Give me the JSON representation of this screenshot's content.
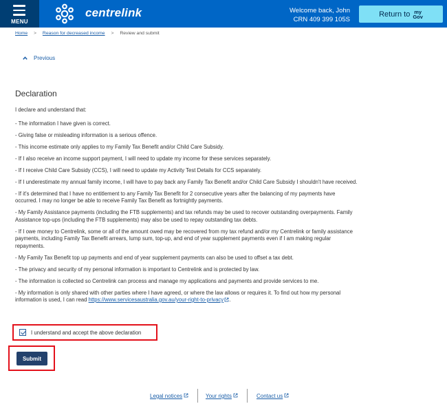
{
  "header": {
    "menu_label": "MENU",
    "brand": "centrelink",
    "welcome_line": "Welcome back, John",
    "crn_line": "CRN 409 399 105S",
    "return_label": "Return to",
    "mygov_line1": "my",
    "mygov_line2": "Gov",
    "colors": {
      "bar": "#0066c6",
      "menu": "#003e73",
      "return_button": "#7fe0f6"
    }
  },
  "breadcrumb": {
    "home": "Home",
    "reason": "Reason for decreased income",
    "current": "Review and submit",
    "separator": ">"
  },
  "nav": {
    "previous": "Previous"
  },
  "declaration": {
    "title": "Declaration",
    "intro": "I declare and understand that:",
    "items": [
      "- The information I have given is correct.",
      "- Giving false or misleading information is a serious offence.",
      "- This income estimate only applies to my Family Tax Benefit and/or Child Care Subsidy.",
      "- If I also receive an income support payment, I will need to update my income for these services separately.",
      "- If I receive Child Care Subsidy (CCS), I will need to update my Activity Test Details for CCS separately.",
      "- If I underestimate my annual family income, I will have to pay back any Family Tax Benefit and/or Child Care Subsidy I shouldn't have received.",
      "- If it's determined that I have no entitlement to any Family Tax Benefit for 2 consecutive years after the balancing of my payments have occurred. I may no longer be able to receive Family Tax Benefit as fortnightly payments.",
      "- My Family Assistance payments (including the FTB supplements) and tax refunds may be used to recover outstanding overpayments. Family Assistance top-ups (including the FTB supplements) may also be used to repay outstanding tax debts.",
      "- If I owe money to Centrelink, some or all of the amount owed may be recovered from my tax refund and/or my Centrelink or family assistance payments, including Family Tax Benefit arrears, lump sum, top-up, and end of year supplement payments even if I am making regular repayments.",
      "- My Family Tax Benefit top up payments and end of year supplement payments can also be used to offset a tax debt.",
      "- The privacy and security of my personal information is important to Centrelink and is protected by law.",
      "- The information is collected so Centrelink can process and manage my applications and payments and provide services to me."
    ],
    "last_item_text": "- My information is only shared with other parties where I have agreed, or where the law allows or requires it. To find out how my personal information is used, I can read ",
    "privacy_link": "https://www.servicesaustralia.gov.au/your-right-to-privacy",
    "last_item_end": "."
  },
  "consent": {
    "label": "I understand and accept the above declaration",
    "checked": true
  },
  "submit": {
    "label": "Submit"
  },
  "footer": {
    "legal": "Legal notices",
    "rights": "Your rights",
    "contact": "Contact us"
  },
  "icons": {
    "menu": "hamburger-icon",
    "logo": "centrelink-star-icon",
    "previous": "chevron-up-icon",
    "external": "external-link-icon"
  },
  "colors": {
    "link": "#1a5ea8",
    "submit": "#23416c",
    "highlight_frame": "#e3101a"
  }
}
